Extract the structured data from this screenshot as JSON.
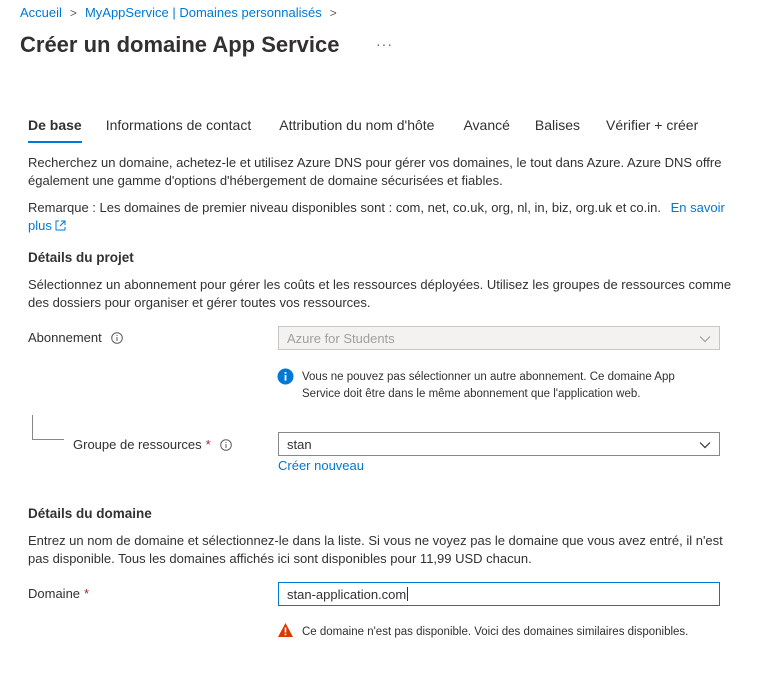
{
  "breadcrumb": [
    {
      "label": "Accueil"
    },
    {
      "label": "MyAppService | Domaines personnalisés"
    }
  ],
  "page": {
    "title": "Créer un domaine App Service",
    "more_label": "···"
  },
  "tabs": [
    {
      "label": "De base",
      "active": true
    },
    {
      "label": "Informations de contact",
      "active": false
    },
    {
      "label": "Attribution du nom d'hôte",
      "active": false
    },
    {
      "label": "Avancé",
      "active": false
    },
    {
      "label": "Balises",
      "active": false
    },
    {
      "label": "Vérifier + créer",
      "active": false
    }
  ],
  "intro": {
    "line1": "Recherchez un domaine, achetez-le et utilisez Azure DNS pour gérer vos domaines, le tout dans Azure. Azure DNS offre",
    "line2": "également une gamme d'options d'hébergement de domaine sécurisées et fiables.",
    "note_line1": "Remarque : Les domaines de premier niveau disponibles sont : com, net, co.uk, org, nl, in, biz, org.uk et co.in.",
    "learn_more_part1": "En savoir",
    "learn_more_part2": "plus"
  },
  "project": {
    "title": "Détails du projet",
    "desc_line1": "Sélectionnez un abonnement pour gérer les coûts et les ressources déployées. Utilisez les groupes de ressources comme",
    "desc_line2": "des dossiers pour organiser et gérer toutes vos ressources.",
    "subscription_label": "Abonnement",
    "subscription_value": "Azure for Students",
    "subscription_info_line1": "Vous ne pouvez pas sélectionner un autre abonnement. Ce domaine App",
    "subscription_info_line2": "Service doit être dans le même abonnement que l'application web.",
    "rg_label": "Groupe de ressources",
    "rg_required": "*",
    "rg_value": "stan",
    "create_new": "Créer nouveau"
  },
  "domain": {
    "title": "Détails du domaine",
    "desc_line1": "Entrez un nom de domaine et sélectionnez-le dans la liste. Si vous ne voyez pas le domaine que vous avez entré, il n'est",
    "desc_line2": "pas disponible. Tous les domaines affichés ici sont disponibles pour 11,99 USD chacun.",
    "label": "Domaine",
    "required": "*",
    "value": "stan-application.com",
    "warning": "Ce domaine n'est pas disponible. Voici des domaines similaires disponibles."
  },
  "colors": {
    "accent": "#0078d4",
    "required": "#a4262c",
    "warning": "#d83b01",
    "info": "#0078d4"
  },
  "icons": {
    "info": "info-circle-icon",
    "warning": "warning-triangle-icon",
    "external": "external-link-icon",
    "chevron": "chevron-down-icon",
    "breadcrumb_sep": "chevron-right-icon"
  }
}
